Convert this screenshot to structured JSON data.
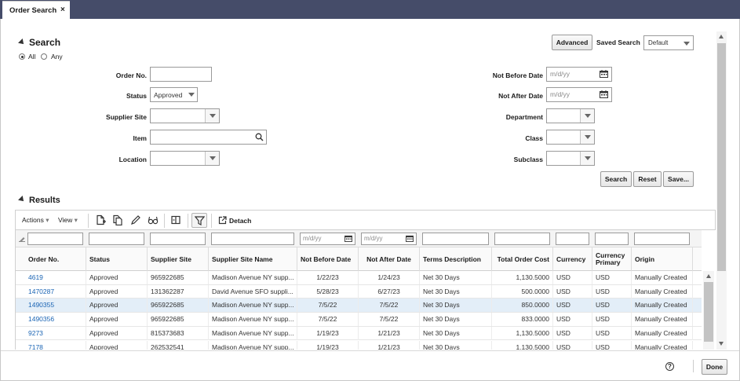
{
  "tab": {
    "label": "Order Search",
    "close": "×"
  },
  "search": {
    "title": "Search",
    "match": {
      "all": "All",
      "any": "Any",
      "selected": "all"
    },
    "advanced_label": "Advanced",
    "saved_search_label": "Saved Search",
    "saved_search_value": "Default",
    "fields": {
      "order_no": {
        "label": "Order No.",
        "value": ""
      },
      "status": {
        "label": "Status",
        "value": "Approved"
      },
      "supplier_site": {
        "label": "Supplier Site",
        "value": ""
      },
      "item": {
        "label": "Item",
        "value": ""
      },
      "location": {
        "label": "Location",
        "value": ""
      },
      "not_before_date": {
        "label": "Not Before Date",
        "placeholder": "m/d/yy"
      },
      "not_after_date": {
        "label": "Not After Date",
        "placeholder": "m/d/yy"
      },
      "department": {
        "label": "Department",
        "value": ""
      },
      "class": {
        "label": "Class",
        "value": ""
      },
      "subclass": {
        "label": "Subclass",
        "value": ""
      }
    },
    "buttons": {
      "search": "Search",
      "reset": "Reset",
      "save": "Save..."
    }
  },
  "results": {
    "title": "Results",
    "toolbar": {
      "actions": "Actions",
      "view": "View",
      "detach": "Detach"
    },
    "filter_placeholder": "m/d/yy",
    "columns": [
      {
        "label": "Order No."
      },
      {
        "label": "Status"
      },
      {
        "label": "Supplier Site"
      },
      {
        "label": "Supplier Site Name"
      },
      {
        "label": "Not Before Date"
      },
      {
        "label": "Not After Date"
      },
      {
        "label": "Terms Description"
      },
      {
        "label": "Total Order Cost"
      },
      {
        "label": "Currency"
      },
      {
        "label": "Currency Primary"
      },
      {
        "label": "Origin"
      }
    ],
    "rows": [
      {
        "order_no": "4619",
        "status": "Approved",
        "supplier_site": "965922685",
        "supplier_site_name": "Madison Avenue NY supp...",
        "not_before": "1/22/23",
        "not_after": "1/24/23",
        "terms": "Net 30 Days",
        "total": "1,130.5000",
        "currency": "USD",
        "currency_primary": "USD",
        "origin": "Manually Created"
      },
      {
        "order_no": "1470287",
        "status": "Approved",
        "supplier_site": "131362287",
        "supplier_site_name": "David Avenue SFO suppli...",
        "not_before": "5/28/23",
        "not_after": "6/27/23",
        "terms": "Net 30 Days",
        "total": "500.0000",
        "currency": "USD",
        "currency_primary": "USD",
        "origin": "Manually Created"
      },
      {
        "order_no": "1490355",
        "status": "Approved",
        "supplier_site": "965922685",
        "supplier_site_name": "Madison Avenue NY supp...",
        "not_before": "7/5/22",
        "not_after": "7/5/22",
        "terms": "Net 30 Days",
        "total": "850.0000",
        "currency": "USD",
        "currency_primary": "USD",
        "origin": "Manually Created"
      },
      {
        "order_no": "1490356",
        "status": "Approved",
        "supplier_site": "965922685",
        "supplier_site_name": "Madison Avenue NY supp...",
        "not_before": "7/5/22",
        "not_after": "7/5/22",
        "terms": "Net 30 Days",
        "total": "833.0000",
        "currency": "USD",
        "currency_primary": "USD",
        "origin": "Manually Created"
      },
      {
        "order_no": "9273",
        "status": "Approved",
        "supplier_site": "815373683",
        "supplier_site_name": "Madison Avenue NY supp...",
        "not_before": "1/19/23",
        "not_after": "1/21/23",
        "terms": "Net 30 Days",
        "total": "1,130.5000",
        "currency": "USD",
        "currency_primary": "USD",
        "origin": "Manually Created"
      },
      {
        "order_no": "7178",
        "status": "Approved",
        "supplier_site": "262532541",
        "supplier_site_name": "Madison Avenue NY supp...",
        "not_before": "1/19/23",
        "not_after": "1/21/23",
        "terms": "Net 30 Days",
        "total": "1,130.5000",
        "currency": "USD",
        "currency_primary": "USD",
        "origin": "Manually Created"
      }
    ]
  },
  "footer": {
    "help": "?",
    "done": "Done"
  },
  "colors": {
    "tabbar": "#454c69",
    "link": "#1a64b4",
    "selected_row": "#e3eef8"
  }
}
